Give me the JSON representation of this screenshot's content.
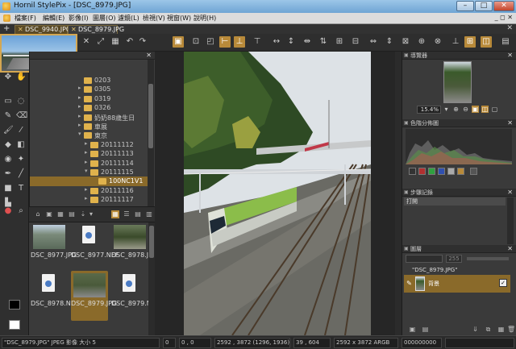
{
  "window": {
    "title": "Hornil StylePix - [DSC_8979.JPG]",
    "buttons": {
      "minimize": "–",
      "maximize": "□",
      "close": "✕"
    }
  },
  "menu": {
    "items": [
      "檔案(F)",
      "編輯(E)",
      "影像(I)",
      "圖層(O)",
      "濾鏡(L)",
      "檢視(V)",
      "視窗(W)",
      "說明(H)"
    ],
    "restore": "_ ◻ ✕"
  },
  "tabs": {
    "add": "+",
    "items": [
      {
        "label": "DSC_9940.JPG",
        "close": "✕"
      },
      {
        "label": "DSC_8979.JPG",
        "close": "✕"
      }
    ],
    "close_all": "✕"
  },
  "folders": [
    {
      "name": "0203",
      "arrow": ""
    },
    {
      "name": "0305",
      "arrow": "▸"
    },
    {
      "name": "0319",
      "arrow": "▸"
    },
    {
      "name": "0326",
      "arrow": "▸"
    },
    {
      "name": "奶奶88歲生日",
      "arrow": "▸"
    },
    {
      "name": "車展",
      "arrow": "▸"
    },
    {
      "name": "東京",
      "arrow": "▾"
    },
    {
      "name": "20111112",
      "arrow": "▸"
    },
    {
      "name": "20111113",
      "arrow": "▸"
    },
    {
      "name": "20111114",
      "arrow": "▸"
    },
    {
      "name": "20111115",
      "arrow": "▾"
    },
    {
      "name": "100NC1V1",
      "arrow": ""
    },
    {
      "name": "20111116",
      "arrow": "▸"
    },
    {
      "name": "20111117",
      "arrow": "▸"
    }
  ],
  "thumbnails": [
    {
      "label": "DSC_8977.JPG",
      "kind": "image",
      "style": "img-a",
      "selected": false
    },
    {
      "label": "DSC_8977.NEF",
      "kind": "file",
      "style": "",
      "selected": false
    },
    {
      "label": "DSC_8978.JPG",
      "kind": "image",
      "style": "img-c",
      "selected": false
    },
    {
      "label": "DSC_8978.NEF",
      "kind": "file",
      "style": "",
      "selected": false
    },
    {
      "label": "DSC_8979.JPG",
      "kind": "image",
      "style": "img-b",
      "selected": true
    },
    {
      "label": "DSC_8979.NEF",
      "kind": "file",
      "style": "",
      "selected": false
    }
  ],
  "panels": {
    "navigator": {
      "title": "導覽器",
      "zoom": "15.4%"
    },
    "histogram": {
      "title": "色階分佈圖"
    },
    "history": {
      "title": "步驟記錄",
      "first_step": "打開"
    },
    "layers": {
      "title": "圖層",
      "opacity": "255",
      "group": "\"DSC_8979.JPG\"",
      "layer_name": "背景",
      "visible": "✓"
    }
  },
  "status": {
    "file": "\"DSC_8979.JPG\" JPEG 影像 大小 5",
    "zoom": "0",
    "coords": "0 , 0",
    "size": "2592 , 3872 (1296, 1936)",
    "pos": "39 , 604",
    "info": "2592 x 3872 ARGB",
    "color": "000000000"
  },
  "colors": {
    "accent": "#b88a3a",
    "selection": "#8a6a2a",
    "panel_bg": "#3a3a3a",
    "titlebar": "#7fb0dc"
  }
}
